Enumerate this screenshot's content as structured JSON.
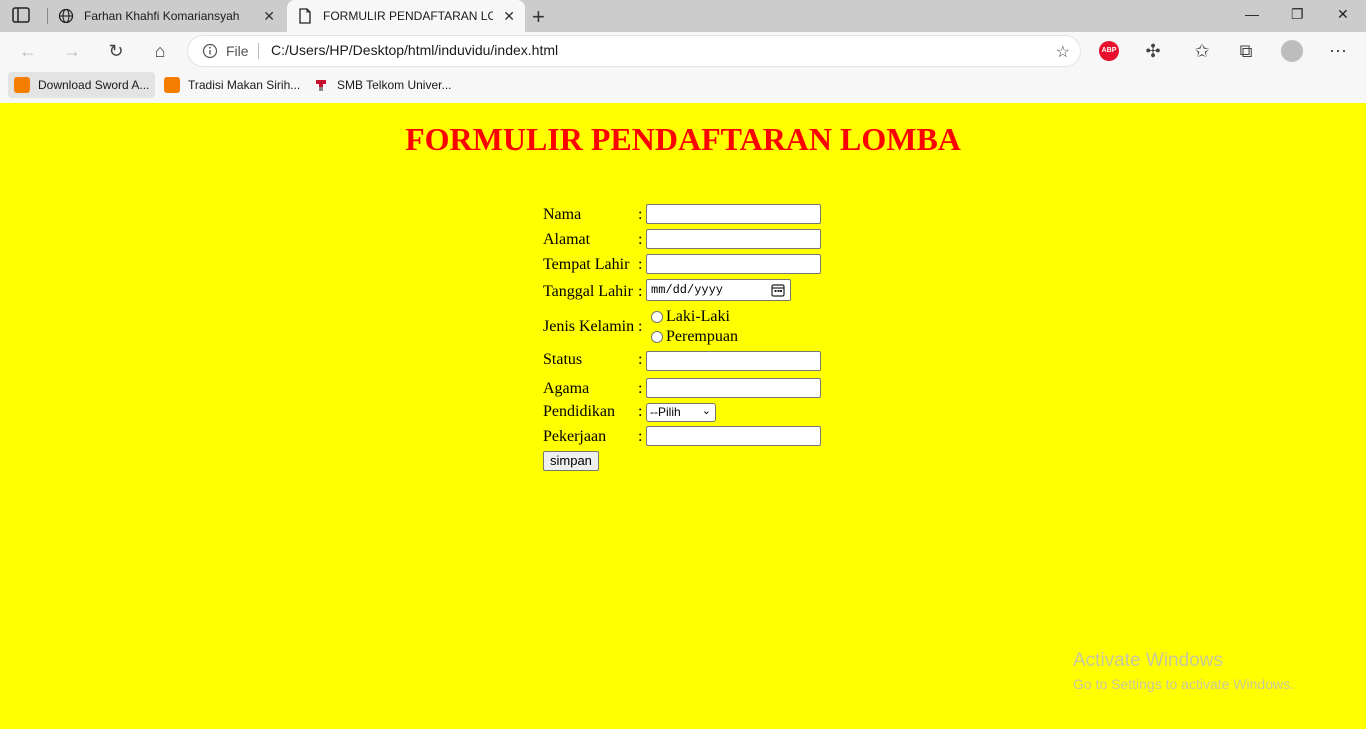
{
  "browser": {
    "tabs": [
      {
        "label": "Farhan Khahfi Komariansyah"
      },
      {
        "label": "FORMULIR PENDAFTARAN LOMBA"
      }
    ],
    "address": {
      "scheme_label": "File",
      "url": "C:/Users/HP/Desktop/html/induvidu/index.html"
    },
    "bookmarks": [
      {
        "label": "Download Sword A..."
      },
      {
        "label": "Tradisi Makan Sirih..."
      },
      {
        "label": "SMB Telkom Univer..."
      }
    ],
    "extension_badge": "ABP"
  },
  "page": {
    "background": "#ffff00",
    "title": "FORMULIR PENDAFTARAN LOMBA",
    "title_color": "#ff0000",
    "fields": {
      "nama": {
        "label": "Nama",
        "value": ""
      },
      "alamat": {
        "label": "Alamat",
        "value": ""
      },
      "tempat_lahir": {
        "label": "Tempat Lahir",
        "value": ""
      },
      "tanggal_lahir": {
        "label": "Tanggal Lahir",
        "placeholder": "mm/dd/yyyy"
      },
      "jenis_kelamin": {
        "label": "Jenis Kelamin",
        "options": [
          "Laki-Laki",
          "Perempuan"
        ]
      },
      "status": {
        "label": "Status",
        "value": ""
      },
      "agama": {
        "label": "Agama",
        "value": ""
      },
      "pendidikan": {
        "label": "Pendidikan",
        "selected": "--Pilih"
      },
      "pekerjaan": {
        "label": "Pekerjaan",
        "value": ""
      }
    },
    "colon": ":",
    "submit_label": "simpan"
  },
  "watermark": {
    "line1": "Activate Windows",
    "line2": "Go to Settings to activate Windows."
  }
}
